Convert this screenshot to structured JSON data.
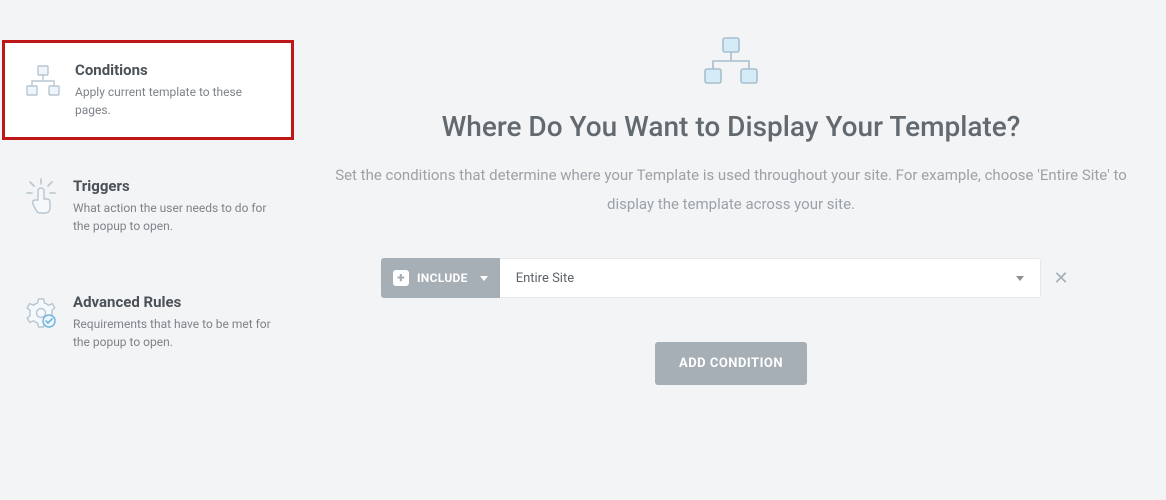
{
  "sidebar": {
    "items": [
      {
        "title": "Conditions",
        "desc": "Apply current template to these pages."
      },
      {
        "title": "Triggers",
        "desc": "What action the user needs to do for the popup to open."
      },
      {
        "title": "Advanced Rules",
        "desc": "Requirements that have to be met for the popup to open."
      }
    ]
  },
  "main": {
    "title": "Where Do You Want to Display Your Template?",
    "description": "Set the conditions that determine where your Template is used throughout your site. For example, choose 'Entire Site' to display the template across your site.",
    "condition": {
      "include_label": "INCLUDE",
      "select_value": "Entire Site"
    },
    "add_button_label": "ADD CONDITION"
  }
}
